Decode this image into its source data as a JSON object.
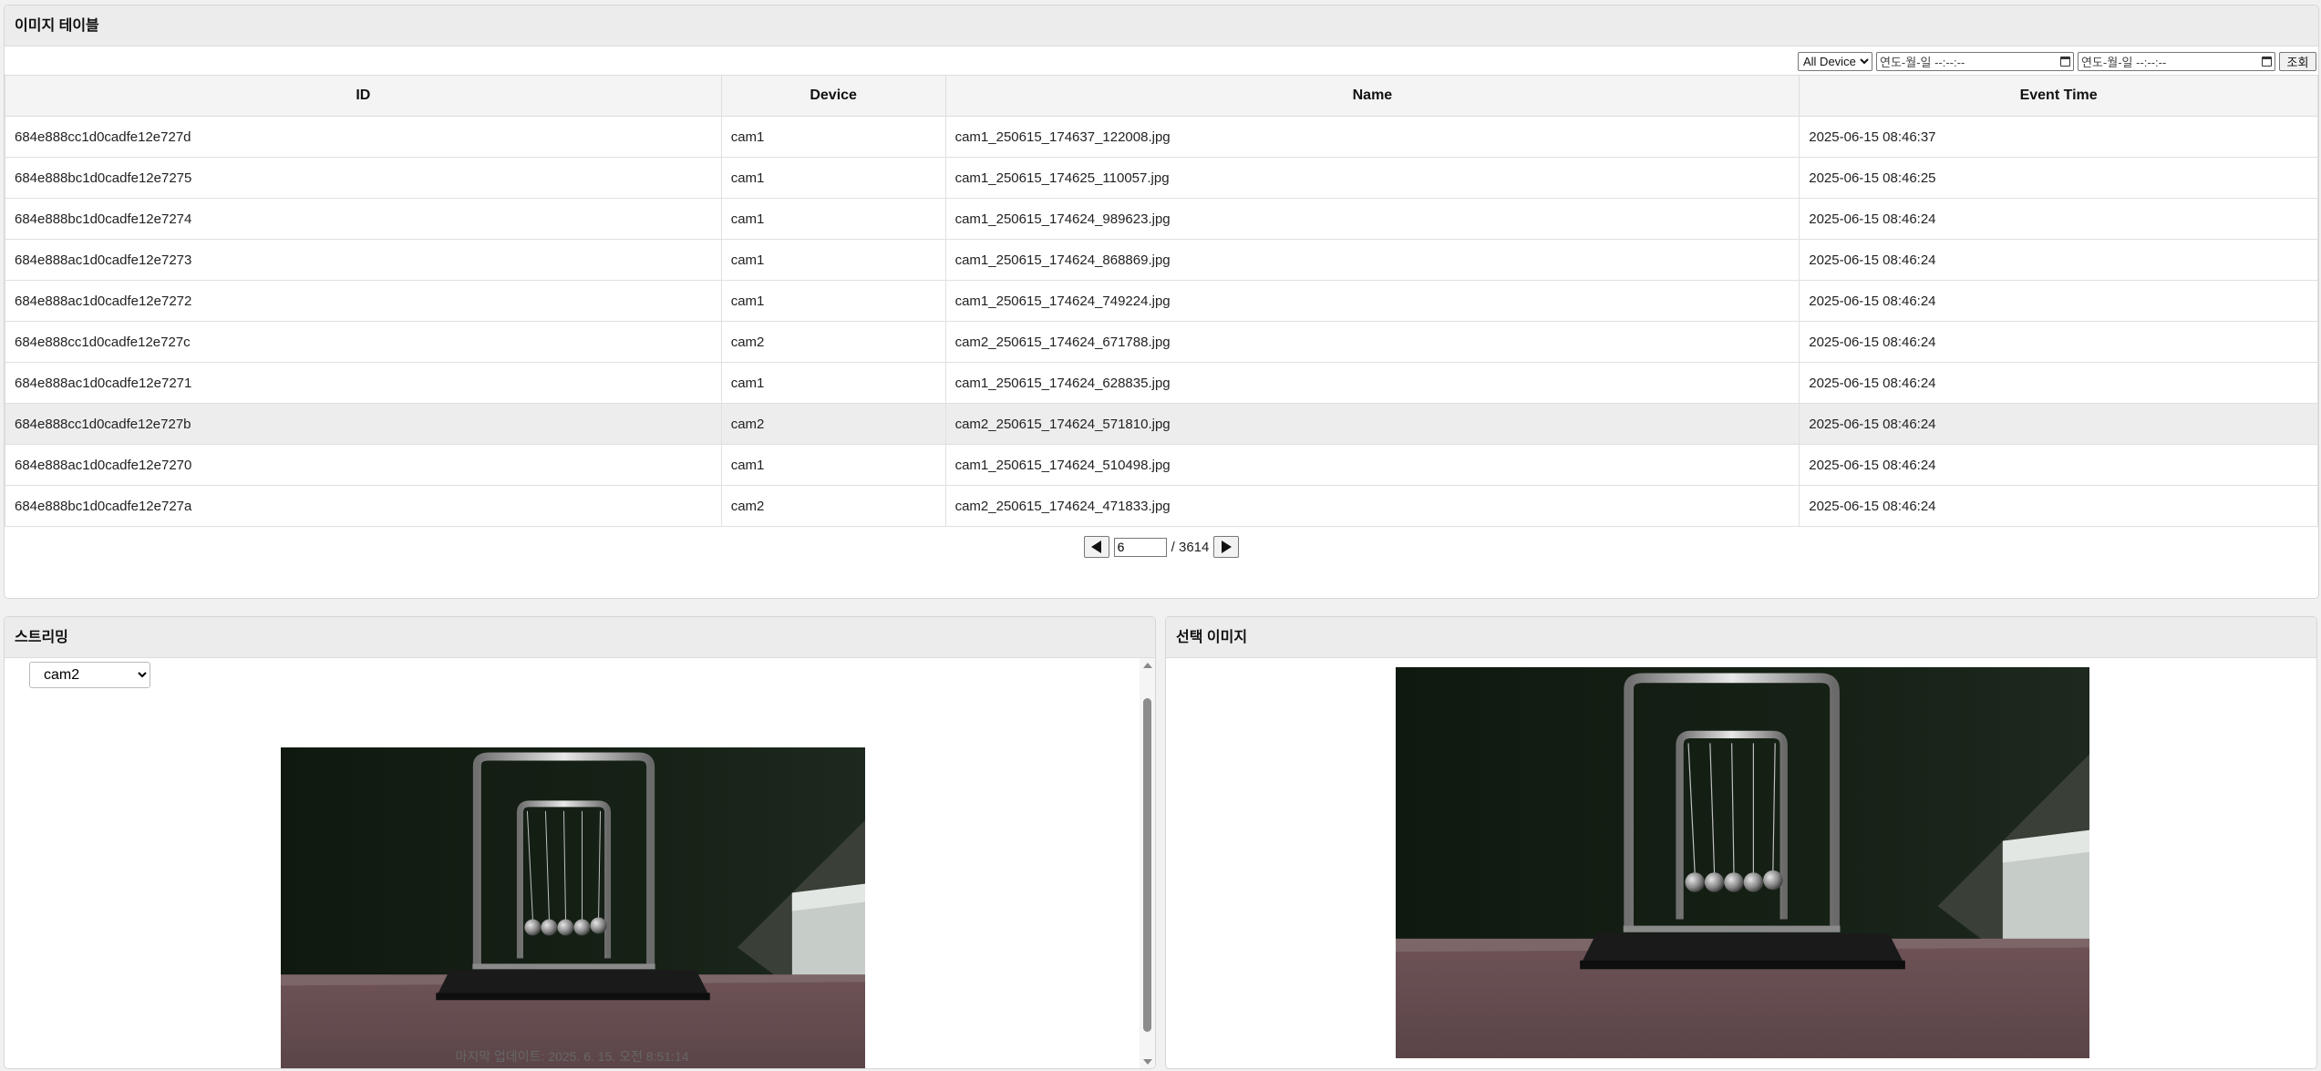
{
  "table_panel": {
    "title": "이미지 테이블",
    "filters": {
      "device_select": "All Device",
      "start_datetime_placeholder": "연도-월-일 --:--:--",
      "end_datetime_placeholder": "연도-월-일 --:--:--",
      "search_button": "조회"
    },
    "columns": [
      "ID",
      "Device",
      "Name",
      "Event Time"
    ],
    "rows": [
      [
        "684e888cc1d0cadfe12e727d",
        "cam1",
        "cam1_250615_174637_122008.jpg",
        "2025-06-15 08:46:37"
      ],
      [
        "684e888bc1d0cadfe12e7275",
        "cam1",
        "cam1_250615_174625_110057.jpg",
        "2025-06-15 08:46:25"
      ],
      [
        "684e888bc1d0cadfe12e7274",
        "cam1",
        "cam1_250615_174624_989623.jpg",
        "2025-06-15 08:46:24"
      ],
      [
        "684e888ac1d0cadfe12e7273",
        "cam1",
        "cam1_250615_174624_868869.jpg",
        "2025-06-15 08:46:24"
      ],
      [
        "684e888ac1d0cadfe12e7272",
        "cam1",
        "cam1_250615_174624_749224.jpg",
        "2025-06-15 08:46:24"
      ],
      [
        "684e888cc1d0cadfe12e727c",
        "cam2",
        "cam2_250615_174624_671788.jpg",
        "2025-06-15 08:46:24"
      ],
      [
        "684e888ac1d0cadfe12e7271",
        "cam1",
        "cam1_250615_174624_628835.jpg",
        "2025-06-15 08:46:24"
      ],
      [
        "684e888cc1d0cadfe12e727b",
        "cam2",
        "cam2_250615_174624_571810.jpg",
        "2025-06-15 08:46:24"
      ],
      [
        "684e888ac1d0cadfe12e7270",
        "cam1",
        "cam1_250615_174624_510498.jpg",
        "2025-06-15 08:46:24"
      ],
      [
        "684e888bc1d0cadfe12e727a",
        "cam2",
        "cam2_250615_174624_471833.jpg",
        "2025-06-15 08:46:24"
      ]
    ],
    "selected_row_index": 7,
    "pagination": {
      "current_page": "6",
      "total_pages": "/ 3614"
    }
  },
  "stream_panel": {
    "title": "스트리밍",
    "camera_select": "cam2",
    "last_update": "마지막 업데이트: 2025. 6. 15. 오전 8:51:14"
  },
  "selected_panel": {
    "title": "선택 이미지"
  },
  "icons": {
    "prev": "triangle-left-icon",
    "next": "triangle-right-icon",
    "calendar": "calendar-icon"
  }
}
